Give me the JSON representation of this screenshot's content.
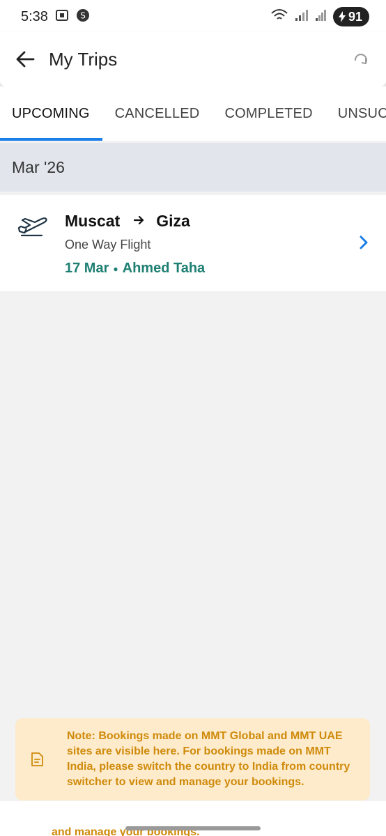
{
  "status_bar": {
    "time": "5:38",
    "battery": "91"
  },
  "header": {
    "title": "My Trips"
  },
  "tabs": [
    {
      "label": "UPCOMING",
      "active": true
    },
    {
      "label": "CANCELLED",
      "active": false
    },
    {
      "label": "COMPLETED",
      "active": false
    },
    {
      "label": "UNSUCCESSFUL",
      "active": false
    }
  ],
  "month": "Mar '26",
  "trip": {
    "from": "Muscat",
    "to": "Giza",
    "type": "One Way Flight",
    "date": "17 Mar",
    "traveller": "Ahmed Taha"
  },
  "note": {
    "text": "Note: Bookings made on MMT Global and MMT UAE sites are visible here. For bookings made on MMT India, please switch the country to India from country switcher to view and manage your bookings."
  },
  "bottom_peek": "and manage your bookings.",
  "colors": {
    "accent": "#1a7fe6",
    "trip_meta": "#1e7f72",
    "note_text": "#cf8a0a",
    "note_bg": "#fdebcc"
  }
}
